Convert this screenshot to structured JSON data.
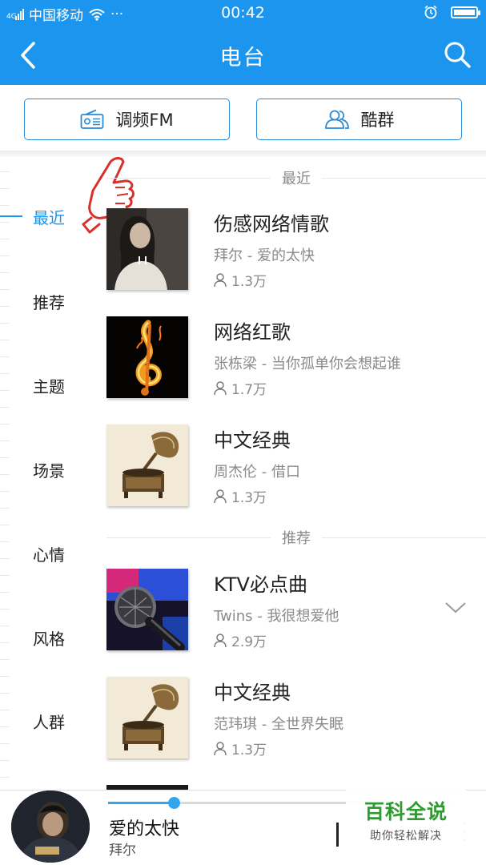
{
  "status_bar": {
    "carrier": "中国移动",
    "time": "00:42"
  },
  "header": {
    "title": "电台"
  },
  "top_buttons": {
    "fm_label": "调频FM",
    "group_label": "酷群"
  },
  "categories": [
    {
      "label": "最近",
      "active": true
    },
    {
      "label": "推荐"
    },
    {
      "label": "主题"
    },
    {
      "label": "场景"
    },
    {
      "label": "心情"
    },
    {
      "label": "风格"
    },
    {
      "label": "人群"
    }
  ],
  "sections": {
    "recent": "最近",
    "recommended": "推荐"
  },
  "items": [
    {
      "title": "伤感网络情歌",
      "subtitle": "拜尔 - 爱的太快",
      "count": "1.3万"
    },
    {
      "title": "网络红歌",
      "subtitle": "张栋梁 - 当你孤单你会想起谁",
      "count": "1.7万"
    },
    {
      "title": "中文经典",
      "subtitle": "周杰伦 - 借口",
      "count": "1.3万"
    },
    {
      "title": "KTV必点曲",
      "subtitle": "Twins - 我很想爱他",
      "count": "2.9万"
    },
    {
      "title": "中文经典",
      "subtitle": "范玮琪 - 全世界失眠",
      "count": "1.3万"
    }
  ],
  "player": {
    "song": "爱的太快",
    "artist": "拜尔",
    "progress": 0.19
  },
  "watermark": {
    "title": "百科全说",
    "subtitle": "助你轻松解决"
  },
  "colors": {
    "brand_blue": "#1b95ee",
    "watermark_green": "#2e9b2e"
  }
}
